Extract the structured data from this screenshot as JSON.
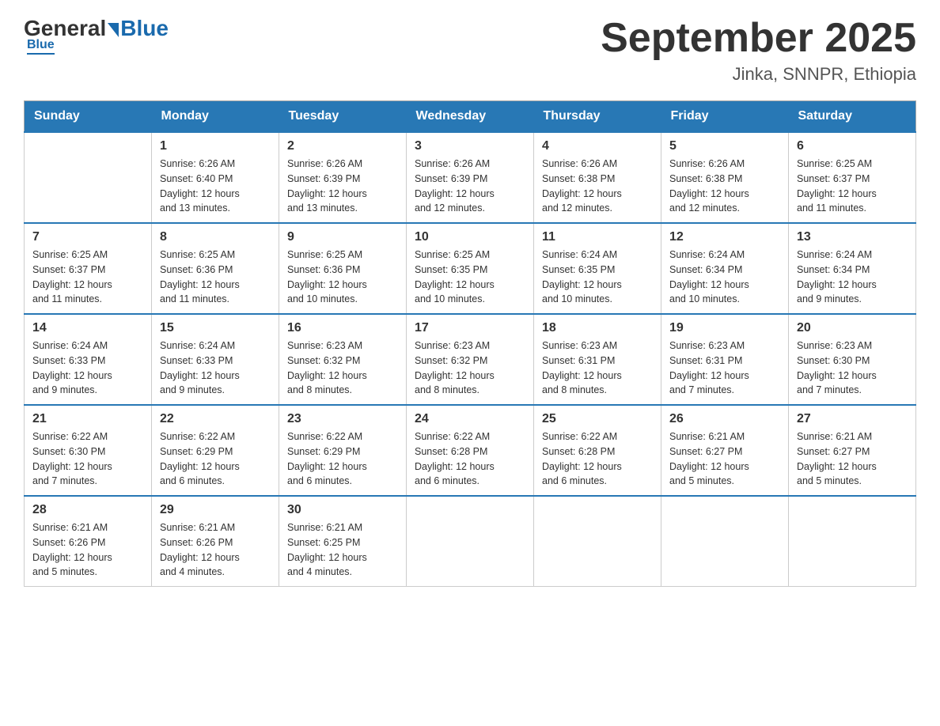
{
  "logo": {
    "general": "General",
    "blue": "Blue"
  },
  "header": {
    "title": "September 2025",
    "subtitle": "Jinka, SNNPR, Ethiopia"
  },
  "days": [
    "Sunday",
    "Monday",
    "Tuesday",
    "Wednesday",
    "Thursday",
    "Friday",
    "Saturday"
  ],
  "weeks": [
    [
      {
        "day": "",
        "info": ""
      },
      {
        "day": "1",
        "info": "Sunrise: 6:26 AM\nSunset: 6:40 PM\nDaylight: 12 hours\nand 13 minutes."
      },
      {
        "day": "2",
        "info": "Sunrise: 6:26 AM\nSunset: 6:39 PM\nDaylight: 12 hours\nand 13 minutes."
      },
      {
        "day": "3",
        "info": "Sunrise: 6:26 AM\nSunset: 6:39 PM\nDaylight: 12 hours\nand 12 minutes."
      },
      {
        "day": "4",
        "info": "Sunrise: 6:26 AM\nSunset: 6:38 PM\nDaylight: 12 hours\nand 12 minutes."
      },
      {
        "day": "5",
        "info": "Sunrise: 6:26 AM\nSunset: 6:38 PM\nDaylight: 12 hours\nand 12 minutes."
      },
      {
        "day": "6",
        "info": "Sunrise: 6:25 AM\nSunset: 6:37 PM\nDaylight: 12 hours\nand 11 minutes."
      }
    ],
    [
      {
        "day": "7",
        "info": "Sunrise: 6:25 AM\nSunset: 6:37 PM\nDaylight: 12 hours\nand 11 minutes."
      },
      {
        "day": "8",
        "info": "Sunrise: 6:25 AM\nSunset: 6:36 PM\nDaylight: 12 hours\nand 11 minutes."
      },
      {
        "day": "9",
        "info": "Sunrise: 6:25 AM\nSunset: 6:36 PM\nDaylight: 12 hours\nand 10 minutes."
      },
      {
        "day": "10",
        "info": "Sunrise: 6:25 AM\nSunset: 6:35 PM\nDaylight: 12 hours\nand 10 minutes."
      },
      {
        "day": "11",
        "info": "Sunrise: 6:24 AM\nSunset: 6:35 PM\nDaylight: 12 hours\nand 10 minutes."
      },
      {
        "day": "12",
        "info": "Sunrise: 6:24 AM\nSunset: 6:34 PM\nDaylight: 12 hours\nand 10 minutes."
      },
      {
        "day": "13",
        "info": "Sunrise: 6:24 AM\nSunset: 6:34 PM\nDaylight: 12 hours\nand 9 minutes."
      }
    ],
    [
      {
        "day": "14",
        "info": "Sunrise: 6:24 AM\nSunset: 6:33 PM\nDaylight: 12 hours\nand 9 minutes."
      },
      {
        "day": "15",
        "info": "Sunrise: 6:24 AM\nSunset: 6:33 PM\nDaylight: 12 hours\nand 9 minutes."
      },
      {
        "day": "16",
        "info": "Sunrise: 6:23 AM\nSunset: 6:32 PM\nDaylight: 12 hours\nand 8 minutes."
      },
      {
        "day": "17",
        "info": "Sunrise: 6:23 AM\nSunset: 6:32 PM\nDaylight: 12 hours\nand 8 minutes."
      },
      {
        "day": "18",
        "info": "Sunrise: 6:23 AM\nSunset: 6:31 PM\nDaylight: 12 hours\nand 8 minutes."
      },
      {
        "day": "19",
        "info": "Sunrise: 6:23 AM\nSunset: 6:31 PM\nDaylight: 12 hours\nand 7 minutes."
      },
      {
        "day": "20",
        "info": "Sunrise: 6:23 AM\nSunset: 6:30 PM\nDaylight: 12 hours\nand 7 minutes."
      }
    ],
    [
      {
        "day": "21",
        "info": "Sunrise: 6:22 AM\nSunset: 6:30 PM\nDaylight: 12 hours\nand 7 minutes."
      },
      {
        "day": "22",
        "info": "Sunrise: 6:22 AM\nSunset: 6:29 PM\nDaylight: 12 hours\nand 6 minutes."
      },
      {
        "day": "23",
        "info": "Sunrise: 6:22 AM\nSunset: 6:29 PM\nDaylight: 12 hours\nand 6 minutes."
      },
      {
        "day": "24",
        "info": "Sunrise: 6:22 AM\nSunset: 6:28 PM\nDaylight: 12 hours\nand 6 minutes."
      },
      {
        "day": "25",
        "info": "Sunrise: 6:22 AM\nSunset: 6:28 PM\nDaylight: 12 hours\nand 6 minutes."
      },
      {
        "day": "26",
        "info": "Sunrise: 6:21 AM\nSunset: 6:27 PM\nDaylight: 12 hours\nand 5 minutes."
      },
      {
        "day": "27",
        "info": "Sunrise: 6:21 AM\nSunset: 6:27 PM\nDaylight: 12 hours\nand 5 minutes."
      }
    ],
    [
      {
        "day": "28",
        "info": "Sunrise: 6:21 AM\nSunset: 6:26 PM\nDaylight: 12 hours\nand 5 minutes."
      },
      {
        "day": "29",
        "info": "Sunrise: 6:21 AM\nSunset: 6:26 PM\nDaylight: 12 hours\nand 4 minutes."
      },
      {
        "day": "30",
        "info": "Sunrise: 6:21 AM\nSunset: 6:25 PM\nDaylight: 12 hours\nand 4 minutes."
      },
      {
        "day": "",
        "info": ""
      },
      {
        "day": "",
        "info": ""
      },
      {
        "day": "",
        "info": ""
      },
      {
        "day": "",
        "info": ""
      }
    ]
  ]
}
